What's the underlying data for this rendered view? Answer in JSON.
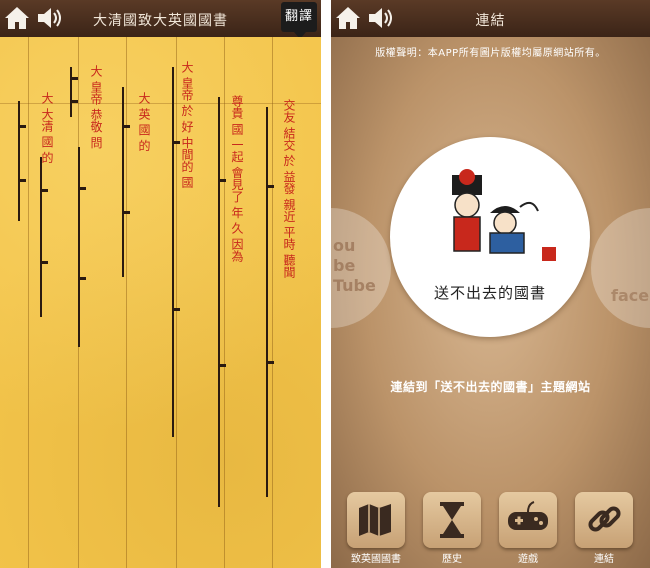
{
  "left": {
    "title": "大清國致大英國國書",
    "translate_label": "翻譯",
    "columns": [
      "交友 結交 於 益發 親近 平時 聽聞",
      "尊貴 國 一起 會見了 年 久 因為",
      "大 皇帝 於 好 中間的 國",
      "大 英 國 的",
      "大 皇帝 恭敬 問",
      "大 大清 國 的"
    ]
  },
  "right": {
    "title": "連結",
    "copyright": "版權聲明：本APP所有圖片版權均屬原網站所有。",
    "logo_caption": "送不出去的國書",
    "link_text": "連結到「送不出去的國書」主題網站",
    "side_left": "ou\nbe\nTube",
    "side_right": "face",
    "nav": [
      "致英國國書",
      "歷史",
      "遊戲",
      "連結"
    ]
  },
  "colors": {
    "topbar": "#4a2e1f",
    "paper": "#f3c44a",
    "red_text": "#c8281c",
    "wood": "#c49b70"
  }
}
